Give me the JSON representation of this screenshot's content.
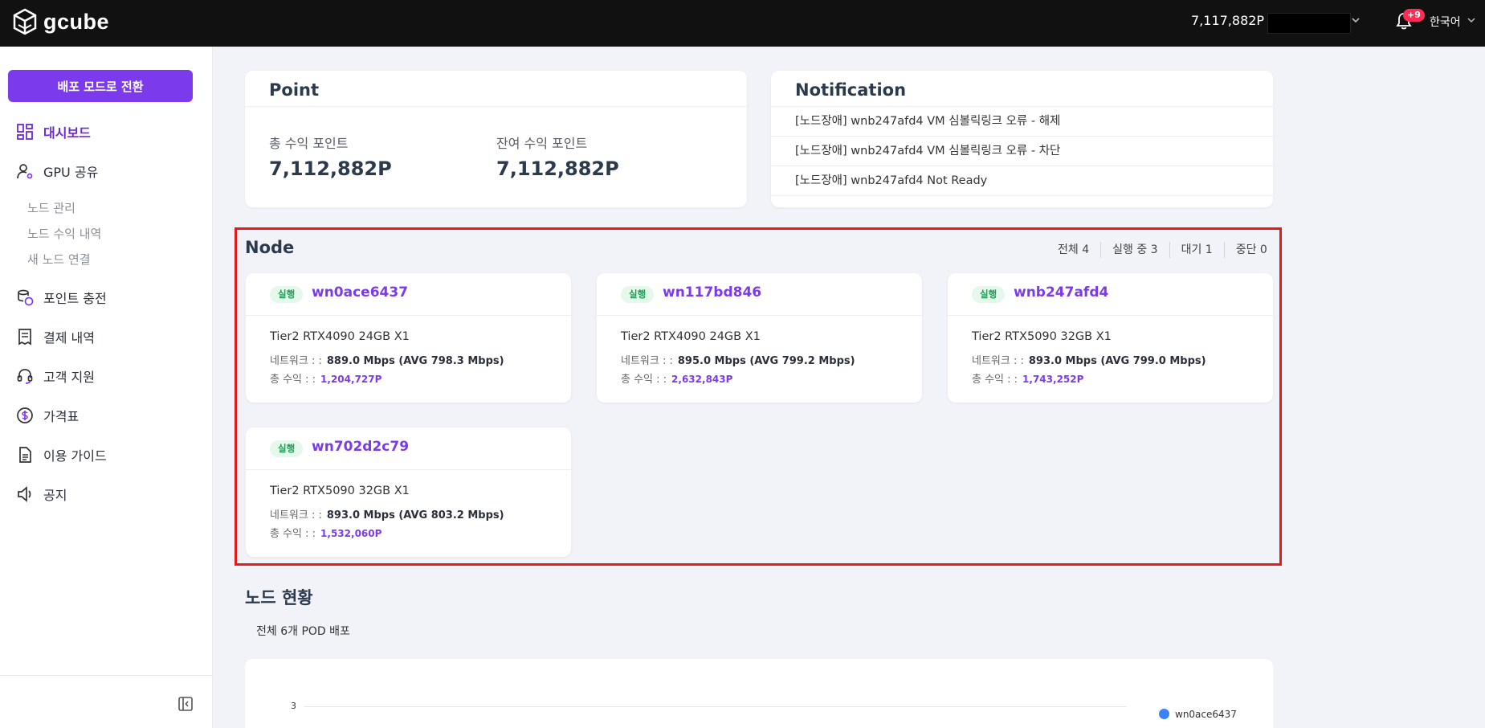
{
  "header": {
    "brand": "gcube",
    "balance": "7,117,882P",
    "notification_badge": "+9",
    "language": "한국어"
  },
  "sidebar": {
    "mode_button": "배포 모드로 전환",
    "items": [
      {
        "label": "대시보드",
        "icon": "dashboard-icon",
        "active": true
      },
      {
        "label": "GPU 공유",
        "icon": "user-gear-icon",
        "active": false
      },
      {
        "label": "포인트 충전",
        "icon": "coins-icon",
        "active": false
      },
      {
        "label": "결제 내역",
        "icon": "receipt-icon",
        "active": false
      },
      {
        "label": "고객 지원",
        "icon": "headset-icon",
        "active": false
      },
      {
        "label": "가격표",
        "icon": "price-icon",
        "active": false
      },
      {
        "label": "이용 가이드",
        "icon": "document-icon",
        "active": false
      },
      {
        "label": "공지",
        "icon": "megaphone-icon",
        "active": false
      }
    ],
    "subitems": [
      "노드 관리",
      "노드 수익 내역",
      "새 노드 연결"
    ]
  },
  "point": {
    "title": "Point",
    "total_label": "총 수익 포인트",
    "total_value": "7,112,882P",
    "remaining_label": "잔여 수익 포인트",
    "remaining_value": "7,112,882P"
  },
  "notification": {
    "title": "Notification",
    "items": [
      "[노드장애] wnb247afd4 VM 심볼릭링크 오류 - 해제",
      "[노드장애] wnb247afd4 VM 심볼릭링크 오류 - 차단",
      "[노드장애] wnb247afd4 Not Ready"
    ]
  },
  "node": {
    "title": "Node",
    "filters": [
      "전체 4",
      "실행 중 3",
      "대기 1",
      "중단 0"
    ],
    "network_label": "네트워크 : :",
    "earnings_label": "총 수익 : :",
    "cards": [
      {
        "status": "실행",
        "name": "wn0ace6437",
        "spec": "Tier2 RTX4090 24GB X1",
        "network": "889.0 Mbps (AVG 798.3 Mbps)",
        "earnings": "1,204,727P"
      },
      {
        "status": "실행",
        "name": "wn117bd846",
        "spec": "Tier2 RTX4090 24GB X1",
        "network": "895.0 Mbps (AVG 799.2 Mbps)",
        "earnings": "2,632,843P"
      },
      {
        "status": "실행",
        "name": "wnb247afd4",
        "spec": "Tier2 RTX5090 32GB X1",
        "network": "893.0 Mbps (AVG 799.0 Mbps)",
        "earnings": "1,743,252P"
      },
      {
        "status": "실행",
        "name": "wn702d2c79",
        "spec": "Tier2 RTX5090 32GB X1",
        "network": "893.0 Mbps (AVG 803.2 Mbps)",
        "earnings": "1,532,060P"
      }
    ]
  },
  "node_status": {
    "title": "노드 현황",
    "subtitle": "전체 6개 POD 배포",
    "y_tick": "3",
    "legend": "wn0ace6437"
  }
}
